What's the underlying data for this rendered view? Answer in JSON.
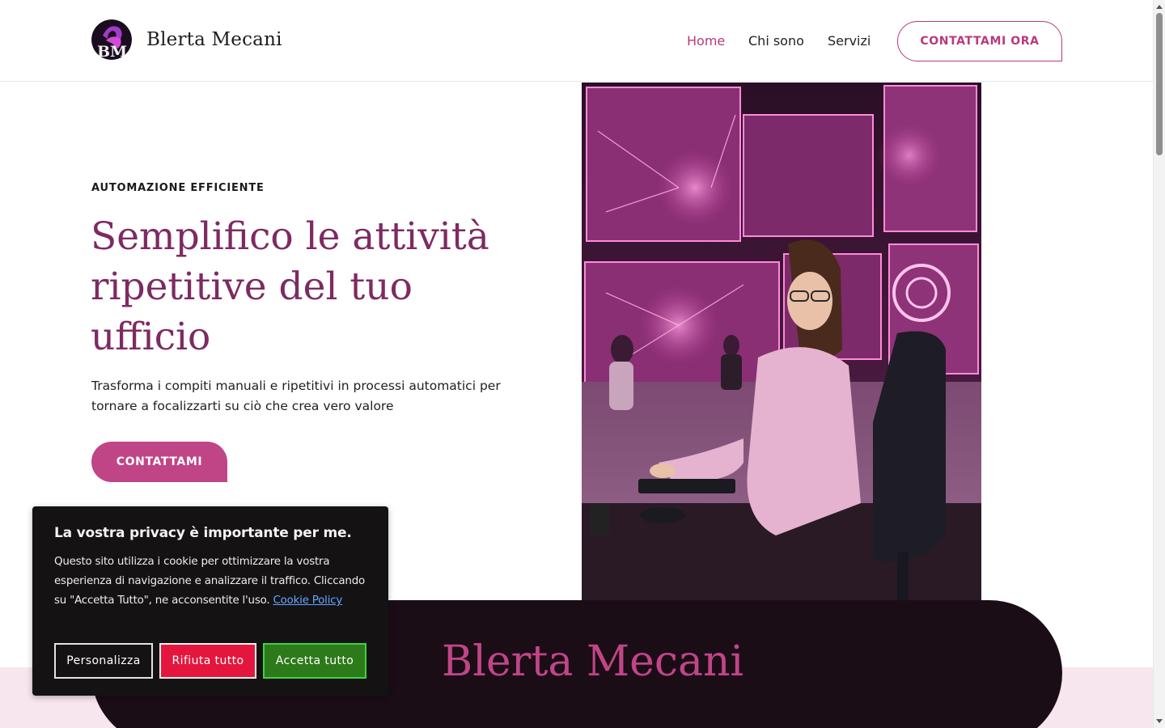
{
  "header": {
    "brand": "Blerta Mecani",
    "logo_text": "BM",
    "nav": [
      "Home",
      "Chi sono",
      "Servizi"
    ],
    "active_nav": "Home",
    "cta": "CONTATTAMI ORA"
  },
  "hero": {
    "eyebrow": "AUTOMAZIONE EFFICIENTE",
    "headline": "Semplifico le attività ripetitive del tuo ufficio",
    "lead": "Trasforma i compiti manuali e ripetitivi in processi automatici per tornare a focalizzarti su ciò che crea vero valore",
    "cta": "CONTATTAMI"
  },
  "band": {
    "title": "Blerta Mecani"
  },
  "cookie": {
    "title": "La vostra privacy è importante per me.",
    "text": "Questo sito utilizza i cookie per ottimizzare la vostra esperienza di navigazione e analizzare il traffico. Cliccando su \"Accetta Tutto\", ne acconsentite l'uso.",
    "link": "Cookie Policy",
    "buttons": {
      "customize": "Personalizza",
      "reject": "Rifiuta tutto",
      "accept": "Accetta tutto"
    }
  },
  "colors": {
    "accent": "#c04587",
    "headline": "#7e2a62",
    "dark_band": "#1b0d16",
    "accept_green": "#2d7a1a",
    "reject_red": "#e5163e"
  },
  "icons": [
    "logo-icon"
  ]
}
